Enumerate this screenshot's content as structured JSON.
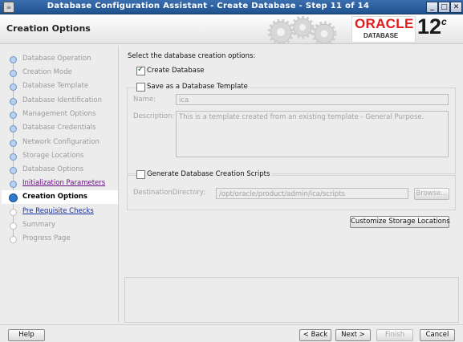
{
  "window": {
    "title": "Database Configuration Assistant - Create Database - Step 11 of 14",
    "controls": [
      "_",
      "□",
      "✕"
    ]
  },
  "header": {
    "page_title": "Creation Options",
    "brand": "ORACLE",
    "brand_sub": "DATABASE",
    "version": "12",
    "version_sup": "c"
  },
  "sidebar": {
    "steps": [
      {
        "label": "Database Operation",
        "state": "done"
      },
      {
        "label": "Creation Mode",
        "state": "done"
      },
      {
        "label": "Database Template",
        "state": "done"
      },
      {
        "label": "Database Identification",
        "state": "done"
      },
      {
        "label": "Management Options",
        "state": "done"
      },
      {
        "label": "Database Credentials",
        "state": "done"
      },
      {
        "label": "Network Configuration",
        "state": "done"
      },
      {
        "label": "Storage Locations",
        "state": "done"
      },
      {
        "label": "Database Options",
        "state": "done"
      },
      {
        "label": "Initialization Parameters",
        "state": "link"
      },
      {
        "label": "Creation Options",
        "state": "current"
      },
      {
        "label": "Pre Requisite Checks",
        "state": "next"
      },
      {
        "label": "Summary",
        "state": "pending"
      },
      {
        "label": "Progress Page",
        "state": "pending"
      }
    ]
  },
  "main": {
    "instruction": "Select the database creation options:",
    "create_database": {
      "label": "Create Database",
      "checked": true
    },
    "save_template": {
      "label": "Save as a Database Template",
      "checked": false
    },
    "name_label": "Name:",
    "name_value": "ica",
    "description_label": "Description:",
    "description_value": "This is a template created from an existing template - General Purpose.",
    "gen_scripts": {
      "label": "Generate Database Creation Scripts",
      "checked": false
    },
    "dest_label": "DestinationDirectory:",
    "dest_value": "/opt/oracle/product/admin/ica/scripts",
    "browse_label": "Browse...",
    "customize_label": "Customize Storage Locations"
  },
  "footer": {
    "help": "Help",
    "back": "< Back",
    "next": "Next >",
    "finish": "Finish",
    "cancel": "Cancel"
  }
}
